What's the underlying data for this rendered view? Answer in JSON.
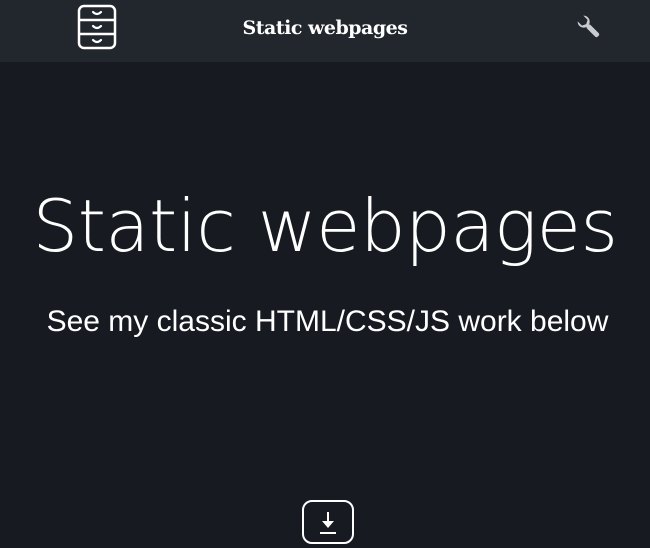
{
  "header": {
    "menu_icon": "filing-cabinet-icon",
    "title": "Static webpages",
    "settings_icon": "wrench-icon"
  },
  "hero": {
    "title": "Static webpages",
    "subtitle": "See my classic HTML/CSS/JS work below"
  },
  "scroll_button": {
    "icon": "download-arrow-icon"
  },
  "colors": {
    "page_background": "#171a21",
    "header_background": "#22262d",
    "text": "#ffffff",
    "wrench_icon": "#c9cbcf"
  }
}
